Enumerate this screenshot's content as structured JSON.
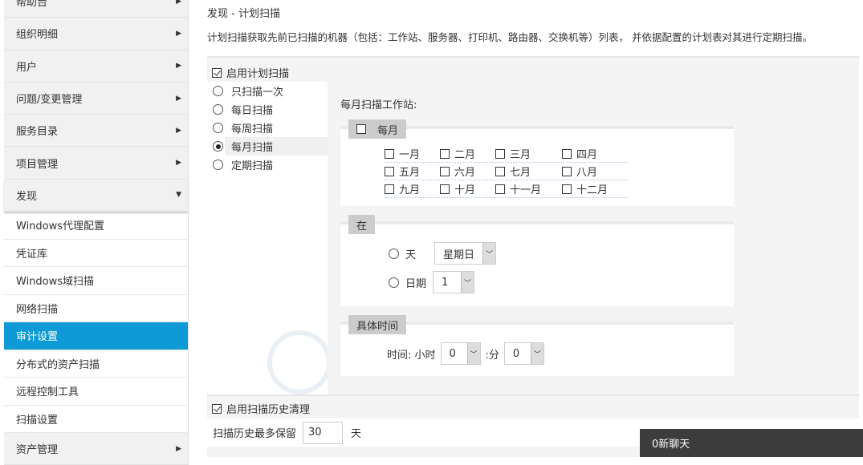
{
  "sidebar": {
    "items": [
      "帮助台",
      "组织明细",
      "用户",
      "问题/变更管理",
      "服务目录",
      "项目管理",
      "发现"
    ],
    "sub_items": [
      "Windows代理配置",
      "凭证库",
      "Windows域扫描",
      "网络扫描",
      "审计设置",
      "分布式的资产扫描",
      "远程控制工具",
      "扫描设置"
    ],
    "active_sub": "审计设置",
    "after": "资产管理"
  },
  "main": {
    "title": "发现 - 计划扫描",
    "description": "计划扫描获取先前已扫描的机器（包括：工作站、服务器、打印机、路由器、交换机等）列表， 并依据配置的计划表对其进行定期扫描。",
    "enable_schedule": "启用计划扫描",
    "scan_options": [
      "只扫描一次",
      "每日扫描",
      "每周扫描",
      "每月扫描",
      "定期扫描"
    ],
    "selected_option": "每月扫描",
    "monthly_label": "每月扫描工作站:",
    "monthly_legend": "每月",
    "months": [
      [
        "一月",
        "二月",
        "三月",
        "四月"
      ],
      [
        "五月",
        "六月",
        "七月",
        "八月"
      ],
      [
        "九月",
        "十月",
        "十一月",
        "十二月"
      ]
    ],
    "at_legend": "在",
    "day_label": "天",
    "day_value": "星期日",
    "date_label": "日期",
    "date_value": "1",
    "time_legend": "具体时间",
    "time_label": "时间: 小时",
    "hour_value": "0",
    "minute_label": ":分",
    "minute_value": "0",
    "enable_history": "启用扫描历史清理",
    "history_label": "扫描历史最多保留",
    "history_value": "30",
    "history_unit": "天"
  },
  "chat": {
    "label": "0新聊天"
  }
}
